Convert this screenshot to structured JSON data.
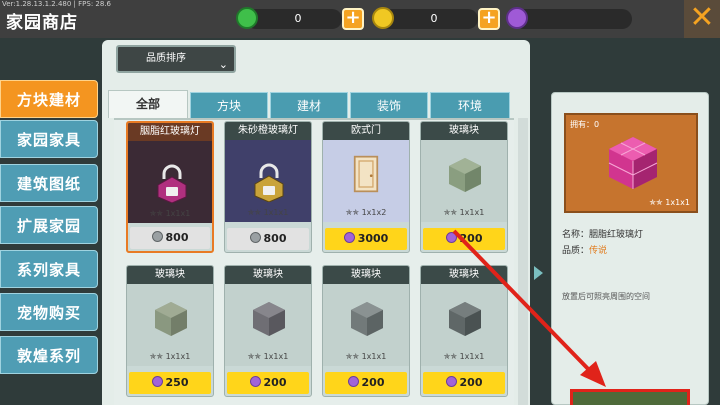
{
  "top": {
    "version": "Ver:1.28.13.1.2.480 | FPS: 28.6",
    "title": "家园商店",
    "currencies": [
      {
        "value": "0",
        "color": "#3fbf4a",
        "icon": "green-gem-icon"
      },
      {
        "value": "0",
        "color": "#f0c823",
        "icon": "gold-coin-icon"
      },
      {
        "value": "",
        "color": "#9f5ad6",
        "icon": "purple-gem-icon"
      }
    ],
    "plus_label": "+",
    "close_label": "✕"
  },
  "sort": {
    "label": "品质排序"
  },
  "sidebar": {
    "items": [
      {
        "label": "方块建材",
        "active": true
      },
      {
        "label": "家园家具"
      },
      {
        "label": "建筑图纸"
      },
      {
        "label": "扩展家园"
      },
      {
        "label": "系列家具"
      },
      {
        "label": "宠物购买"
      },
      {
        "label": "敦煌系列"
      }
    ]
  },
  "tabs": [
    {
      "label": "全部",
      "active": true
    },
    {
      "label": "方块"
    },
    {
      "label": "建材"
    },
    {
      "label": "装饰"
    },
    {
      "label": "环境"
    }
  ],
  "cards": [
    {
      "name": "胭脂红玻璃灯",
      "size": "1x1x1",
      "price": "800",
      "price_style": "gray",
      "gem": "silver",
      "selected": true,
      "thumb": "#3b2a35",
      "locked": true,
      "lock_color": "#b0307f"
    },
    {
      "name": "朱砂橙玻璃灯",
      "size": "1x1x1",
      "price": "800",
      "price_style": "gray",
      "gem": "silver",
      "thumb": "#40406a",
      "locked": true,
      "lock_color": "#c9a33a"
    },
    {
      "name": "欧式门",
      "size": "1x1x2",
      "price": "3000",
      "price_style": "gold",
      "gem": "purple",
      "thumb": "#c6cde6"
    },
    {
      "name": "玻璃块",
      "size": "1x1x1",
      "price": "200",
      "price_style": "gold",
      "gem": "purple",
      "thumb": "#c2d1cd",
      "block": "#8a9e80"
    },
    {
      "name": "玻璃块",
      "size": "1x1x1",
      "price": "250",
      "price_style": "gold",
      "gem": "purple",
      "thumb": "#c2d1cd",
      "block": "#8a9880"
    },
    {
      "name": "玻璃块",
      "size": "1x1x1",
      "price": "200",
      "price_style": "gold",
      "gem": "purple",
      "thumb": "#c2d1cd",
      "block": "#6f6e74"
    },
    {
      "name": "玻璃块",
      "size": "1x1x1",
      "price": "200",
      "price_style": "gold",
      "gem": "purple",
      "thumb": "#c2d1cd",
      "block": "#727a7a"
    },
    {
      "name": "玻璃块",
      "size": "1x1x1",
      "price": "200",
      "price_style": "gold",
      "gem": "purple",
      "thumb": "#c2d1cd",
      "block": "#5f6767"
    }
  ],
  "detail": {
    "owned": "拥有：0",
    "size": "1x1x1",
    "name_label": "名称：",
    "name_value": "胭脂红玻璃灯",
    "quality_label": "品质：",
    "quality_value": "传说",
    "description": "放置后可照亮周围的空间"
  },
  "colors": {
    "accent": "#f49520",
    "highlight": "#e0231a"
  }
}
